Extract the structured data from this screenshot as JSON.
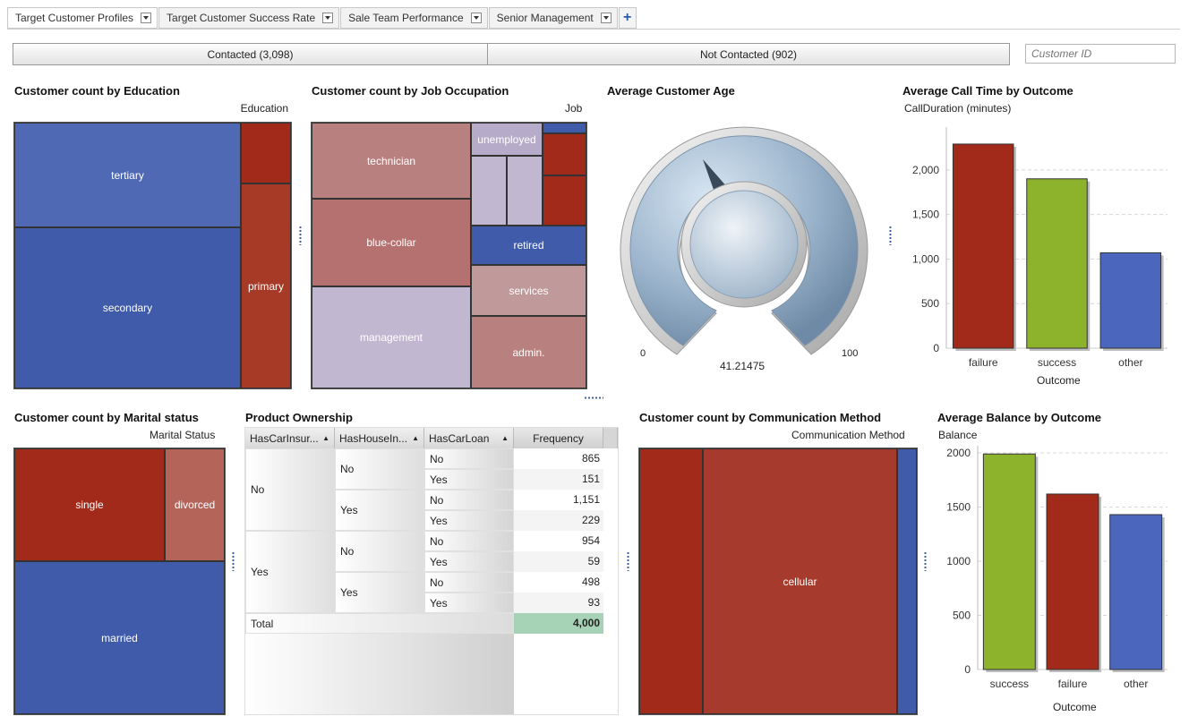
{
  "tabs": [
    {
      "label": "Target Customer Profiles"
    },
    {
      "label": "Target Customer Success Rate"
    },
    {
      "label": "Sale Team Performance"
    },
    {
      "label": "Senior Management"
    }
  ],
  "add_tab_symbol": "+",
  "filters": {
    "contacted": "Contacted (3,098)",
    "not_contacted": "Not Contacted (902)",
    "customer_id_placeholder": "Customer ID"
  },
  "colors": {
    "red": "#a22a1a",
    "blue": "#3f5ba9",
    "blue_light": "#5069b5",
    "green": "#8db22b",
    "pink": "#b98080",
    "lavender": "#c2b7d0"
  },
  "education": {
    "title": "Customer count by Education",
    "legend": "Education",
    "labels": {
      "tertiary": "tertiary",
      "secondary": "secondary",
      "primary": "primary"
    }
  },
  "job": {
    "title": "Customer count by Job Occupation",
    "legend": "Job",
    "labels": {
      "technician": "technician",
      "blue_collar": "blue-collar",
      "management": "management",
      "unemployed": "unemployed",
      "retired": "retired",
      "services": "services",
      "admin": "admin."
    }
  },
  "age": {
    "title": "Average Customer Age",
    "min": "0",
    "max": "100",
    "value": "41.21475",
    "value_num": 41.21475
  },
  "calltime": {
    "title": "Average Call Time by Outcome",
    "ylabel": "CallDuration (minutes)",
    "xlabel": "Outcome",
    "ticks": [
      "2,000",
      "1,500",
      "1,000",
      "500",
      "0"
    ],
    "chart_data": {
      "type": "bar",
      "categories": [
        "failure",
        "success",
        "other"
      ],
      "values": [
        2290,
        1900,
        1070
      ],
      "ylim": [
        0,
        2400
      ],
      "colors": [
        "#a22a1a",
        "#8db22b",
        "#4a66bd"
      ]
    }
  },
  "marital": {
    "title": "Customer count by Marital status",
    "legend": "Marital Status",
    "labels": {
      "single": "single",
      "divorced": "divorced",
      "married": "married"
    }
  },
  "product": {
    "title": "Product Ownership",
    "headers": [
      "HasCarInsur...",
      "HasHouseIn...",
      "HasCarLoan",
      "Frequency"
    ],
    "level1": [
      "No",
      "Yes"
    ],
    "level2": [
      "No",
      "Yes",
      "No",
      "Yes"
    ],
    "level3": [
      "No",
      "Yes",
      "No",
      "Yes",
      "No",
      "Yes",
      "No",
      "Yes"
    ],
    "freq": [
      "865",
      "151",
      "1,151",
      "229",
      "954",
      "59",
      "498",
      "93"
    ],
    "total_label": "Total",
    "total_value": "4,000"
  },
  "comm": {
    "title": "Customer count by Communication Method",
    "legend": "Communication Method",
    "label_cellular": "cellular"
  },
  "balance": {
    "title": "Average Balance by Outcome",
    "ylabel": "Balance",
    "xlabel": "Outcome",
    "ticks": [
      "2000",
      "1500",
      "1000",
      "500",
      "0"
    ],
    "chart_data": {
      "type": "bar",
      "categories": [
        "success",
        "failure",
        "other"
      ],
      "values": [
        1990,
        1620,
        1430
      ],
      "ylim": [
        0,
        2000
      ],
      "colors": [
        "#8db22b",
        "#a22a1a",
        "#4a66bd"
      ]
    }
  }
}
